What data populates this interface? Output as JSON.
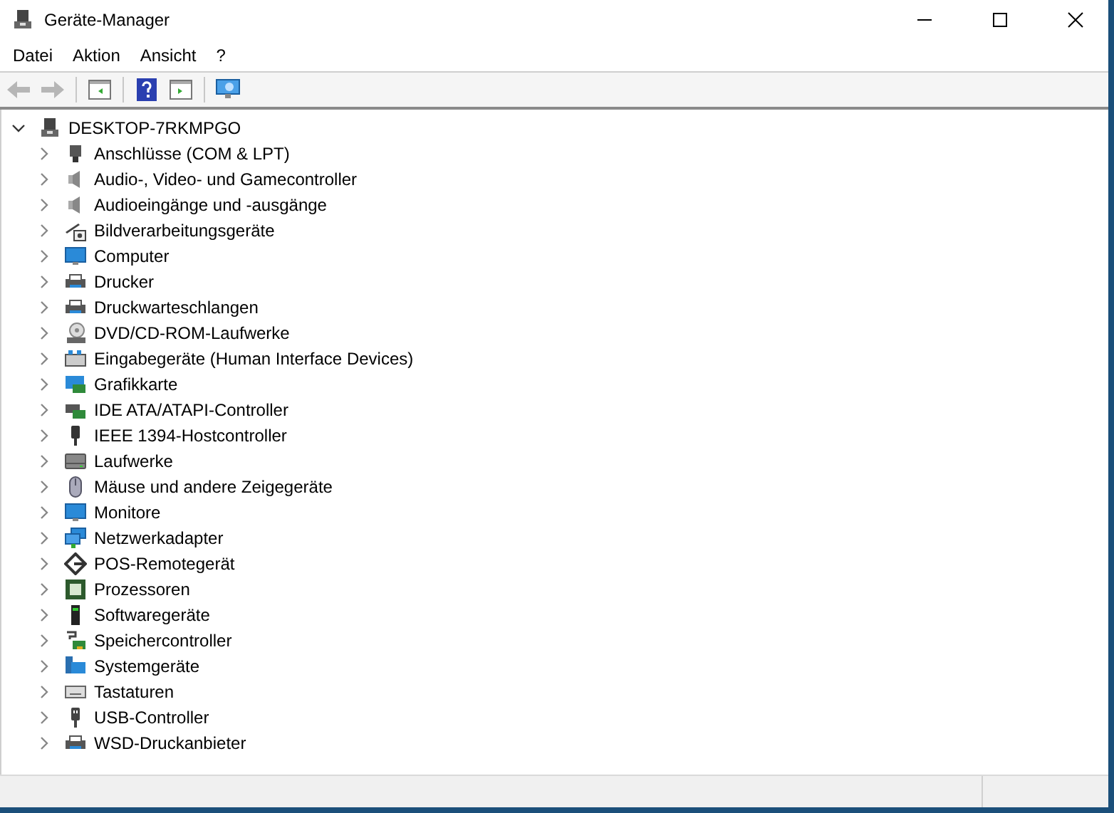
{
  "window": {
    "title": "Geräte-Manager"
  },
  "menu": [
    "Datei",
    "Aktion",
    "Ansicht",
    "?"
  ],
  "toolbar": [
    {
      "kind": "back",
      "disabled": true
    },
    {
      "kind": "forward",
      "disabled": true
    },
    {
      "kind": "separator"
    },
    {
      "kind": "tree-pane",
      "disabled": false
    },
    {
      "kind": "separator"
    },
    {
      "kind": "help",
      "disabled": false
    },
    {
      "kind": "action-pane",
      "disabled": false
    },
    {
      "kind": "separator"
    },
    {
      "kind": "scan",
      "disabled": false
    }
  ],
  "tree": {
    "label": "DESKTOP-7RKMPGO",
    "expanded": true,
    "children": [
      {
        "label": "Anschlüsse (COM & LPT)",
        "expanded": false
      },
      {
        "label": "Audio-, Video- und Gamecontroller",
        "expanded": false
      },
      {
        "label": "Audioeingänge und -ausgänge",
        "expanded": false
      },
      {
        "label": "Bildverarbeitungsgeräte",
        "expanded": false
      },
      {
        "label": "Computer",
        "expanded": false
      },
      {
        "label": "Drucker",
        "expanded": false
      },
      {
        "label": "Druckwarteschlangen",
        "expanded": false
      },
      {
        "label": "DVD/CD-ROM-Laufwerke",
        "expanded": false
      },
      {
        "label": "Eingabegeräte (Human Interface Devices)",
        "expanded": false
      },
      {
        "label": "Grafikkarte",
        "expanded": false
      },
      {
        "label": "IDE ATA/ATAPI-Controller",
        "expanded": false
      },
      {
        "label": "IEEE 1394-Hostcontroller",
        "expanded": false
      },
      {
        "label": "Laufwerke",
        "expanded": false
      },
      {
        "label": "Mäuse und andere Zeigegeräte",
        "expanded": false
      },
      {
        "label": "Monitore",
        "expanded": false
      },
      {
        "label": "Netzwerkadapter",
        "expanded": false
      },
      {
        "label": "POS-Remotegerät",
        "expanded": false
      },
      {
        "label": "Prozessoren",
        "expanded": false
      },
      {
        "label": "Softwaregeräte",
        "expanded": false
      },
      {
        "label": "Speichercontroller",
        "expanded": false
      },
      {
        "label": "Systemgeräte",
        "expanded": false
      },
      {
        "label": "Tastaturen",
        "expanded": false
      },
      {
        "label": "USB-Controller",
        "expanded": false
      },
      {
        "label": "WSD-Druckanbieter",
        "expanded": false
      }
    ]
  }
}
